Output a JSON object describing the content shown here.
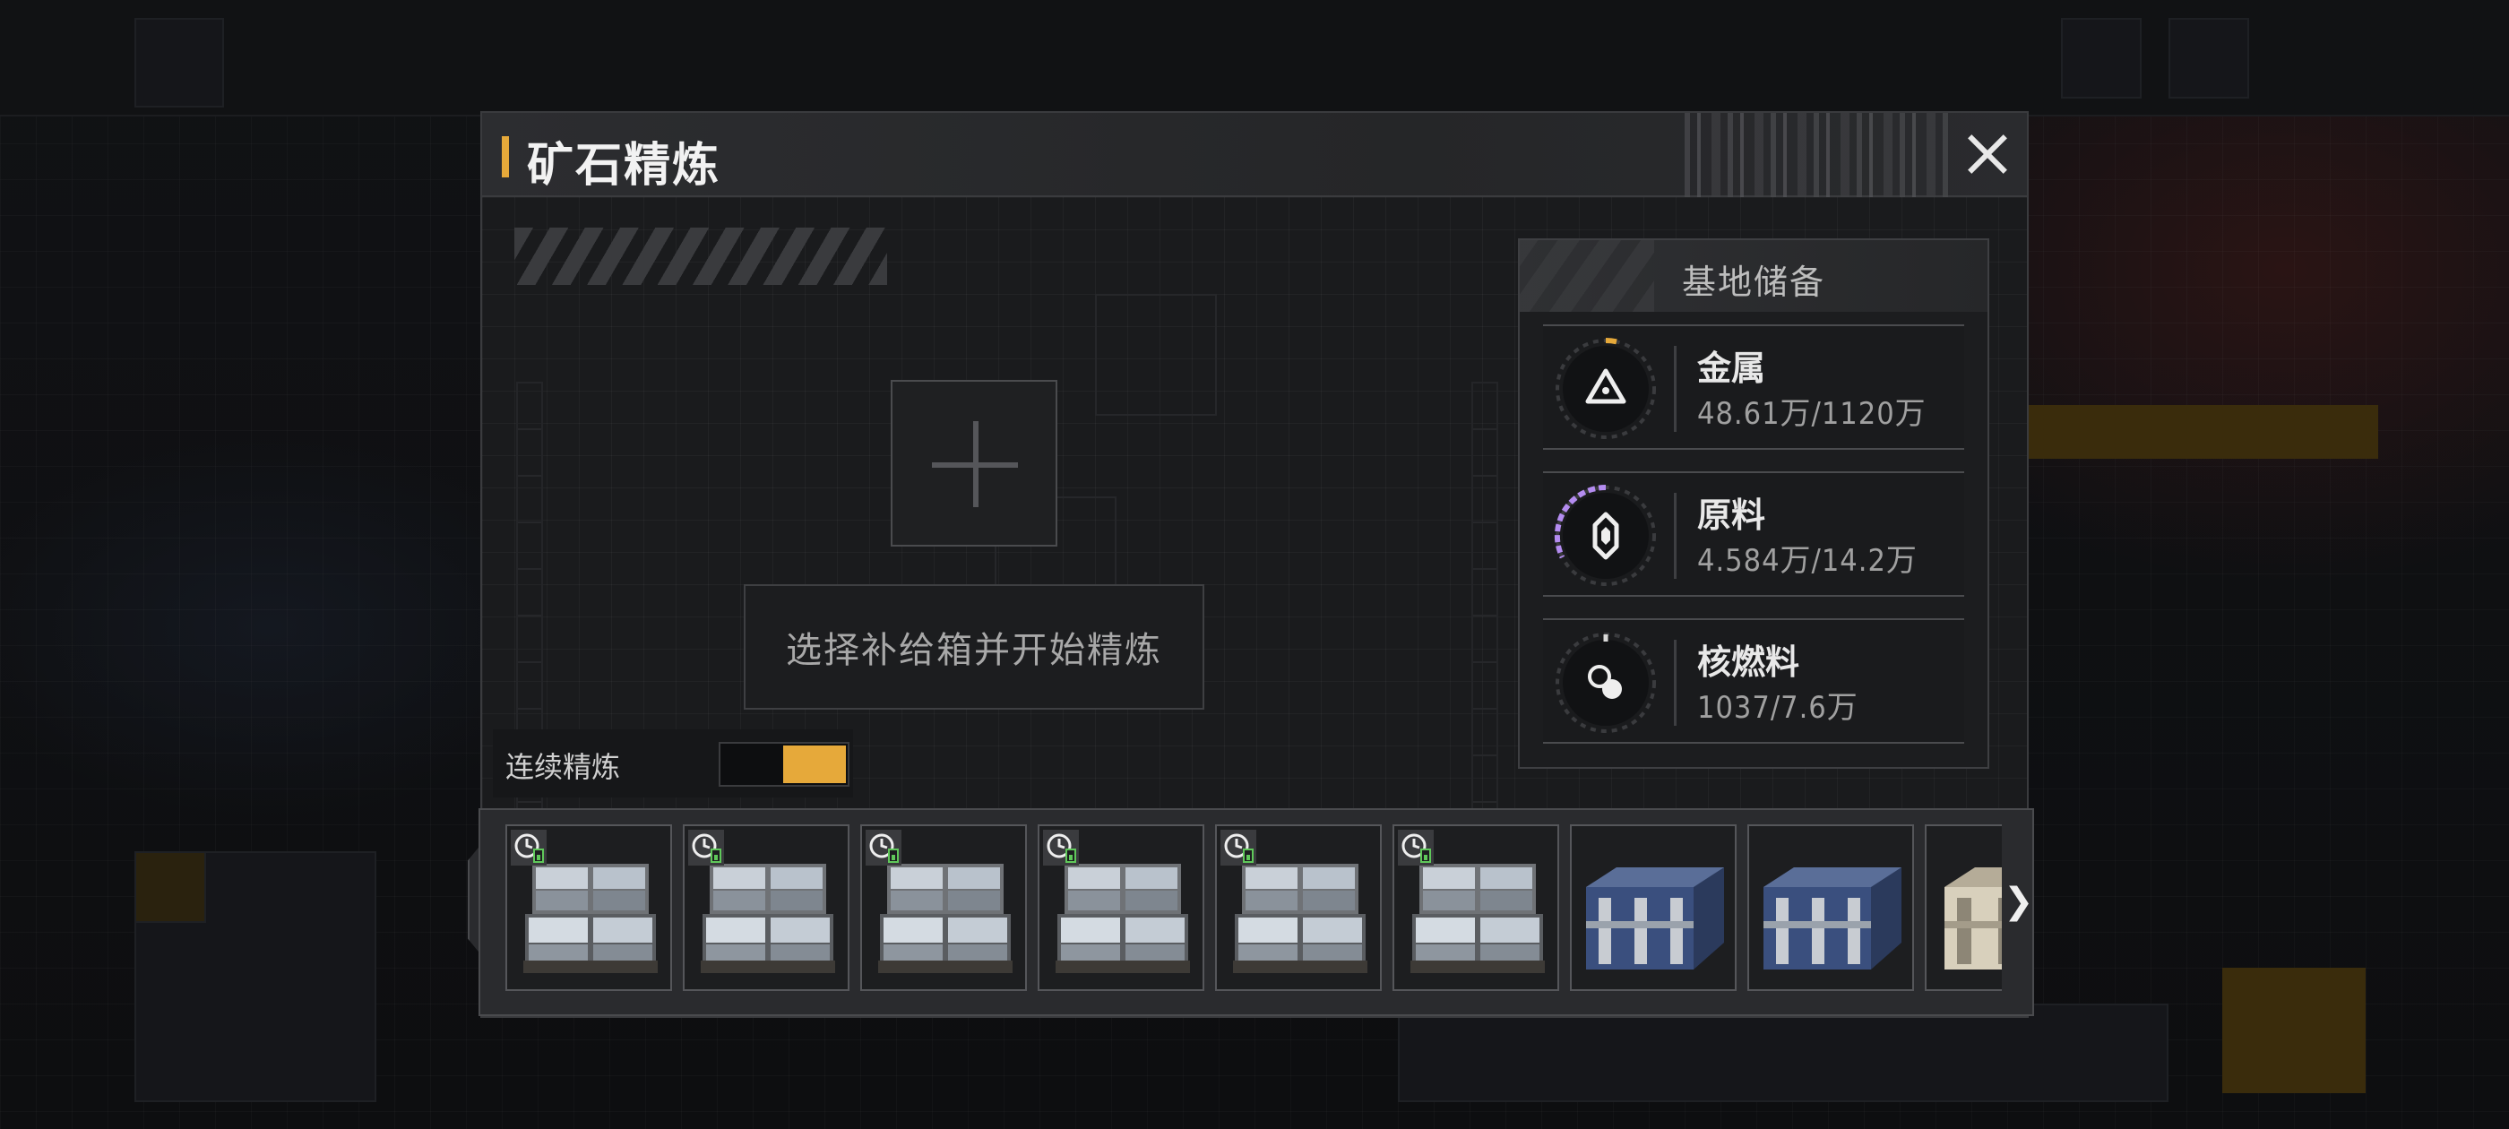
{
  "modal": {
    "title": "矿石精炼",
    "close_icon": "close-icon"
  },
  "refine": {
    "hint": "选择补给箱并开始精炼",
    "add_icon": "plus-icon",
    "continuous_label": "连续精炼",
    "continuous_on": true
  },
  "reserves": {
    "title": "基地储备",
    "items": [
      {
        "name": "金属",
        "value": "48.61万/1120万",
        "icon": "metal-icon",
        "ring_color": "#e6a93a",
        "fill": 0.04
      },
      {
        "name": "原料",
        "value": "4.584万/14.2万",
        "icon": "raw-material-icon",
        "ring_color": "#b48cf0",
        "fill": 0.32
      },
      {
        "name": "核燃料",
        "value": "1037/7.6万",
        "icon": "nuclear-fuel-icon",
        "ring_color": "#d8d8d8",
        "fill": 0.01
      }
    ]
  },
  "inventory": {
    "slots": [
      {
        "kind": "small-crates",
        "timed": true,
        "timer_icon": "clock-icon"
      },
      {
        "kind": "small-crates",
        "timed": true,
        "timer_icon": "clock-icon"
      },
      {
        "kind": "small-crates",
        "timed": true,
        "timer_icon": "clock-icon"
      },
      {
        "kind": "small-crates",
        "timed": true,
        "timer_icon": "clock-icon"
      },
      {
        "kind": "small-crates",
        "timed": true,
        "timer_icon": "clock-icon"
      },
      {
        "kind": "small-crates",
        "timed": true,
        "timer_icon": "clock-icon"
      },
      {
        "kind": "blue-case",
        "timed": false
      },
      {
        "kind": "blue-case",
        "timed": false
      },
      {
        "kind": "white-case",
        "timed": false
      }
    ],
    "next_icon": "chevron-right-icon",
    "next_label": "❯"
  },
  "colors": {
    "accent": "#e6a93a",
    "panel": "#1a1b1d",
    "slot_border": "#55565a"
  }
}
